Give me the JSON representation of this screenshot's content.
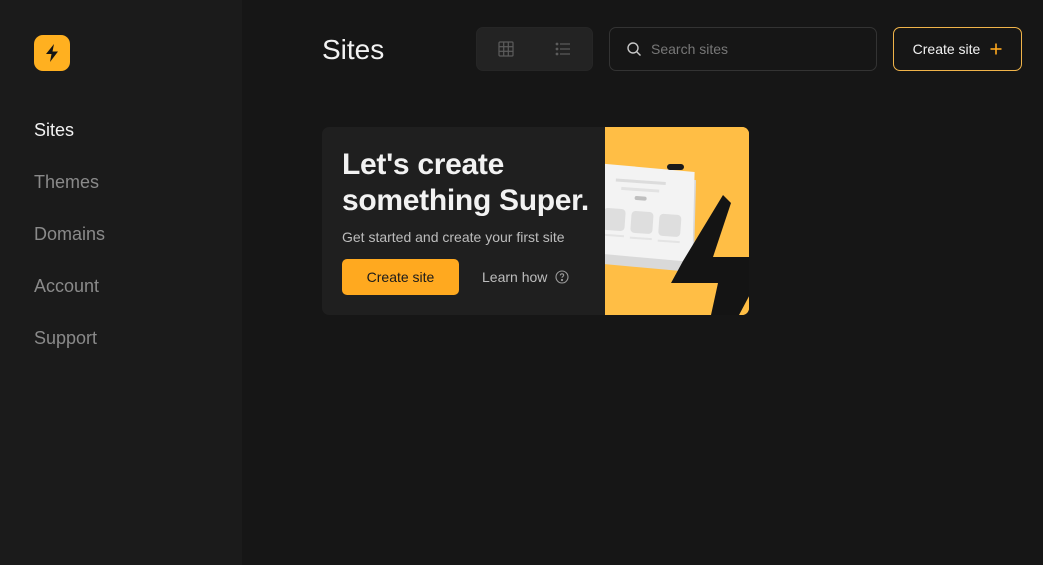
{
  "app": {
    "accent": "#ffa91f",
    "logo_icon": "lightning-bolt-icon"
  },
  "sidebar": {
    "items": [
      {
        "label": "Sites",
        "active": true
      },
      {
        "label": "Themes",
        "active": false
      },
      {
        "label": "Domains",
        "active": false
      },
      {
        "label": "Account",
        "active": false
      },
      {
        "label": "Support",
        "active": false
      }
    ]
  },
  "header": {
    "title": "Sites",
    "view_toggle": [
      "grid-icon",
      "list-icon"
    ],
    "search": {
      "placeholder": "Search sites",
      "value": ""
    },
    "create_label": "Create site"
  },
  "empty_card": {
    "headline": "Let's create something Super.",
    "subtitle": "Get started and create your first site",
    "primary_label": "Create site",
    "secondary_label": "Learn how"
  }
}
